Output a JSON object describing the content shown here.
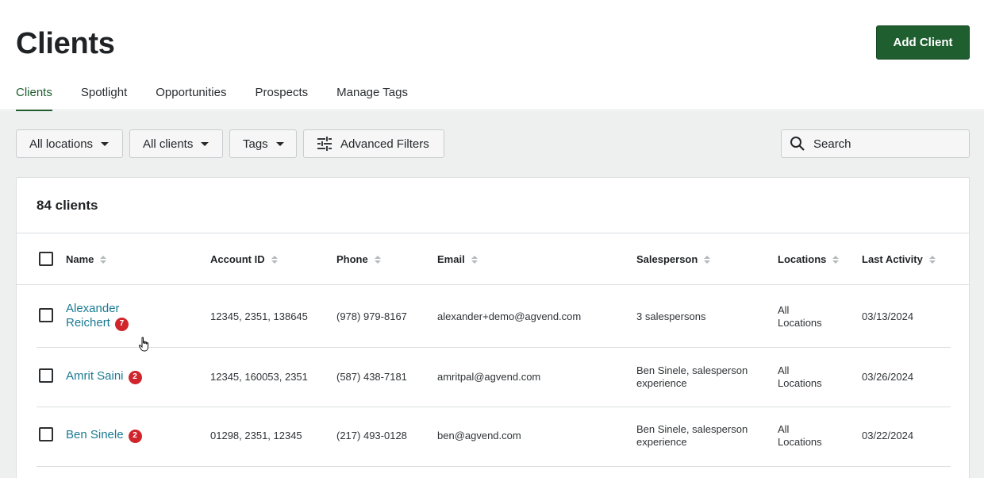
{
  "page": {
    "title": "Clients",
    "add_button": "Add Client"
  },
  "tabs": [
    {
      "label": "Clients",
      "active": true
    },
    {
      "label": "Spotlight",
      "active": false
    },
    {
      "label": "Opportunities",
      "active": false
    },
    {
      "label": "Prospects",
      "active": false
    },
    {
      "label": "Manage Tags",
      "active": false
    }
  ],
  "filters": {
    "locations": "All locations",
    "clients": "All clients",
    "tags": "Tags",
    "advanced": "Advanced Filters",
    "search_placeholder": "Search"
  },
  "table": {
    "count_label": "84 clients",
    "columns": [
      "Name",
      "Account ID",
      "Phone",
      "Email",
      "Salesperson",
      "Locations",
      "Last Activity"
    ],
    "rows": [
      {
        "name_line1": "Alexander",
        "name_line2": "Reichert",
        "badge": "7",
        "account_id": "12345, 2351, 138645",
        "phone": "(978) 979-8167",
        "email": "alexander+demo@agvend.com",
        "salesperson_line1": "3 salespersons",
        "salesperson_line2": "",
        "locations_line1": "All",
        "locations_line2": "Locations",
        "last_activity": "03/13/2024"
      },
      {
        "name_line1": "Amrit Saini",
        "name_line2": "",
        "badge": "2",
        "account_id": "12345, 160053, 2351",
        "phone": "(587) 438-7181",
        "email": "amritpal@agvend.com",
        "salesperson_line1": "Ben Sinele, salesperson",
        "salesperson_line2": "experience",
        "locations_line1": "All",
        "locations_line2": "Locations",
        "last_activity": "03/26/2024"
      },
      {
        "name_line1": "Ben Sinele",
        "name_line2": "",
        "badge": "2",
        "account_id": "01298, 2351, 12345",
        "phone": "(217) 493-0128",
        "email": "ben@agvend.com",
        "salesperson_line1": "Ben Sinele, salesperson",
        "salesperson_line2": "experience",
        "locations_line1": "All",
        "locations_line2": "Locations",
        "last_activity": "03/22/2024"
      }
    ]
  },
  "colors": {
    "brand_green": "#1e5e2f",
    "link_teal": "#1a7a93",
    "badge_red": "#d0252c"
  },
  "icons": {
    "sliders": "advanced-filters-icon",
    "search": "search-icon",
    "cursor": "hand-pointer-icon"
  }
}
